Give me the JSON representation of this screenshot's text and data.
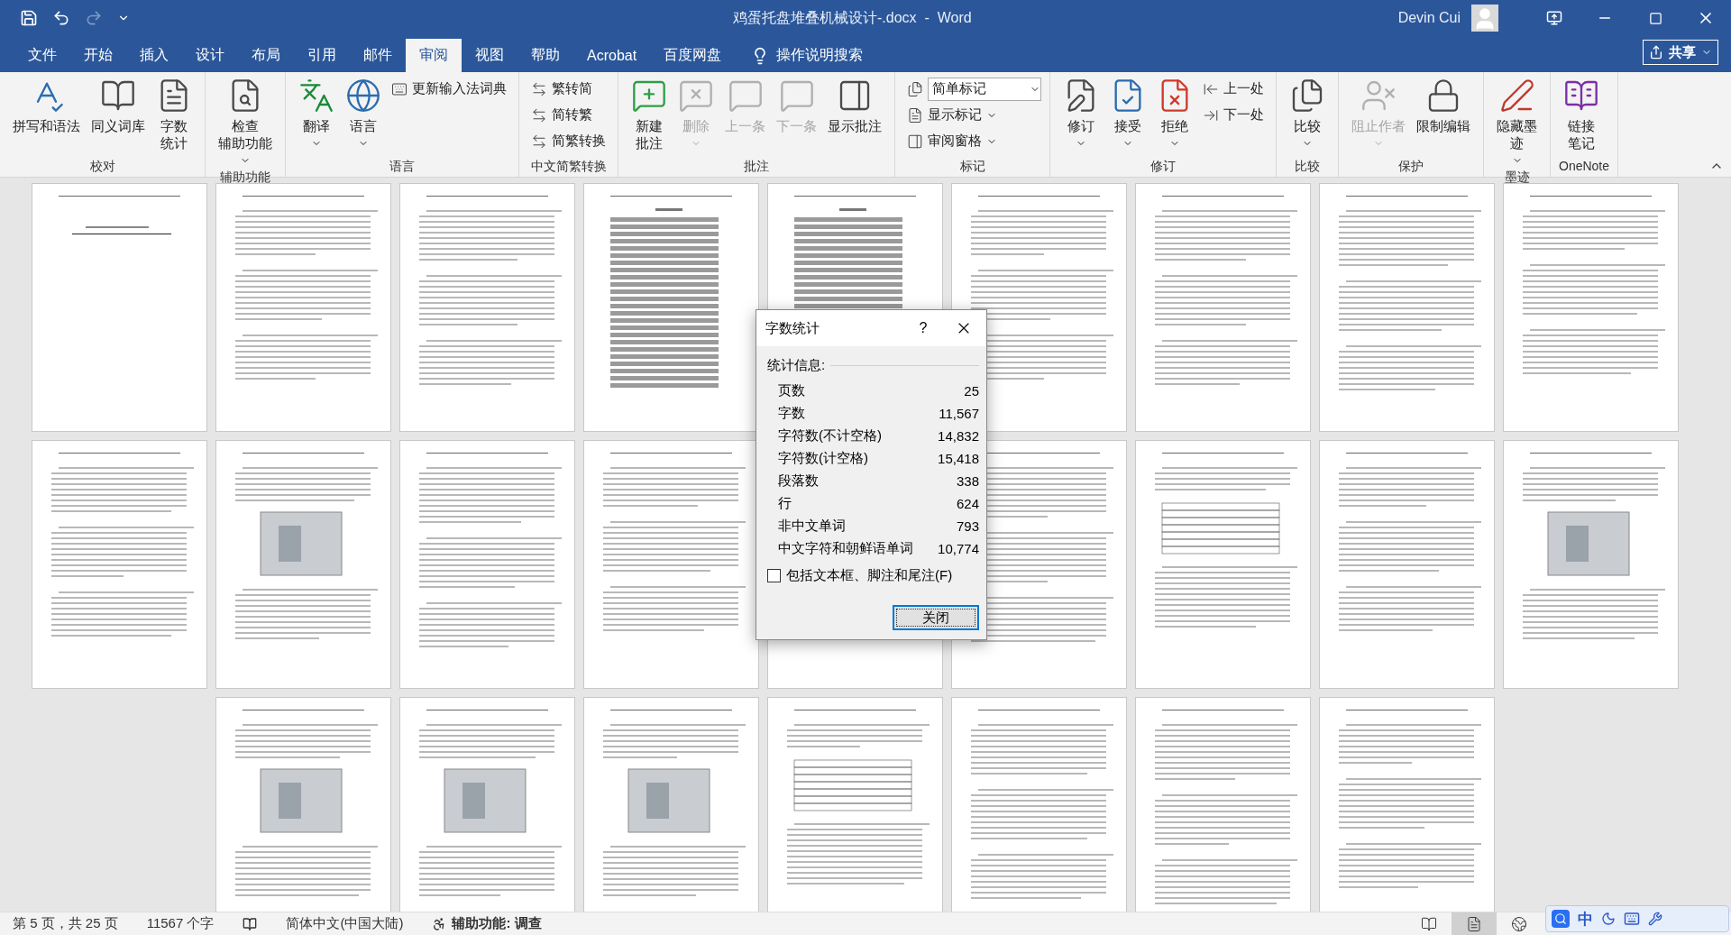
{
  "title_bar": {
    "title": "鸡蛋托盘堆叠机械设计-.docx  -  Word",
    "user": "Devin Cui"
  },
  "menu_tabs": [
    {
      "label": "文件",
      "selected": false
    },
    {
      "label": "开始",
      "selected": false
    },
    {
      "label": "插入",
      "selected": false
    },
    {
      "label": "设计",
      "selected": false
    },
    {
      "label": "布局",
      "selected": false
    },
    {
      "label": "引用",
      "selected": false
    },
    {
      "label": "邮件",
      "selected": false
    },
    {
      "label": "审阅",
      "selected": true
    },
    {
      "label": "视图",
      "selected": false
    },
    {
      "label": "帮助",
      "selected": false
    },
    {
      "label": "Acrobat",
      "selected": false
    },
    {
      "label": "百度网盘",
      "selected": false
    }
  ],
  "tell_me": "操作说明搜索",
  "share": "共享",
  "ribbon_groups": [
    {
      "label": "校对",
      "items": [
        {
          "kind": "large",
          "lines": [
            "拼写和语法"
          ],
          "disabled": false
        },
        {
          "kind": "large",
          "lines": [
            "同义词库"
          ],
          "disabled": false
        },
        {
          "kind": "large",
          "lines": [
            "字数",
            "统计"
          ],
          "disabled": false
        }
      ]
    },
    {
      "label": "辅助功能",
      "items": [
        {
          "kind": "large",
          "lines": [
            "检查",
            "辅助功能"
          ],
          "disabled": false,
          "dropdown": true
        }
      ]
    },
    {
      "label": "语言",
      "items": [
        {
          "kind": "large",
          "lines": [
            "翻译"
          ],
          "disabled": false,
          "dropdown": true
        },
        {
          "kind": "large",
          "lines": [
            "语言"
          ],
          "disabled": false,
          "dropdown": true
        },
        {
          "kind": "small",
          "lines": [
            "更新输入法词典"
          ],
          "disabled": false
        }
      ]
    },
    {
      "label": "中文简繁转换",
      "items": [
        {
          "kind": "small",
          "lines": [
            "繁转简"
          ],
          "disabled": false
        },
        {
          "kind": "small",
          "lines": [
            "简转繁"
          ],
          "disabled": false
        },
        {
          "kind": "small",
          "lines": [
            "简繁转换"
          ],
          "disabled": false
        }
      ]
    },
    {
      "label": "批注",
      "items": [
        {
          "kind": "large",
          "lines": [
            "新建",
            "批注"
          ],
          "disabled": false
        },
        {
          "kind": "large",
          "lines": [
            "删除"
          ],
          "disabled": true,
          "dropdown": true
        },
        {
          "kind": "large",
          "lines": [
            "上一条"
          ],
          "disabled": true
        },
        {
          "kind": "large",
          "lines": [
            "下一条"
          ],
          "disabled": true
        },
        {
          "kind": "large",
          "lines": [
            "显示批注"
          ],
          "disabled": false
        }
      ]
    },
    {
      "label": "标记",
      "items": [
        {
          "kind": "select",
          "lines": [
            "简单标记"
          ],
          "disabled": false
        },
        {
          "kind": "small",
          "lines": [
            "显示标记"
          ],
          "disabled": false,
          "dropdown": true
        },
        {
          "kind": "small",
          "lines": [
            "审阅窗格"
          ],
          "disabled": false,
          "dropdown": true
        }
      ]
    },
    {
      "label": "修订",
      "items": [
        {
          "kind": "large",
          "lines": [
            "修订"
          ],
          "disabled": false,
          "dropdown": true
        },
        {
          "kind": "large",
          "lines": [
            "接受"
          ],
          "disabled": false,
          "dropdown": true
        },
        {
          "kind": "large",
          "lines": [
            "拒绝"
          ],
          "disabled": false,
          "dropdown": true
        },
        {
          "kind": "small",
          "lines": [
            "上一处"
          ],
          "disabled": false
        },
        {
          "kind": "small",
          "lines": [
            "下一处"
          ],
          "disabled": false
        }
      ]
    },
    {
      "label": "比较",
      "items": [
        {
          "kind": "large",
          "lines": [
            "比较"
          ],
          "disabled": false,
          "dropdown": true
        }
      ]
    },
    {
      "label": "保护",
      "items": [
        {
          "kind": "large",
          "lines": [
            "阻止作者"
          ],
          "disabled": true,
          "dropdown": true
        },
        {
          "kind": "large",
          "lines": [
            "限制编辑"
          ],
          "disabled": false
        }
      ]
    },
    {
      "label": "墨迹",
      "items": [
        {
          "kind": "large",
          "lines": [
            "隐藏墨",
            "迹"
          ],
          "disabled": false,
          "dropdown": true
        }
      ]
    },
    {
      "label": "OneNote",
      "items": [
        {
          "kind": "large",
          "lines": [
            "链接",
            "笔记"
          ],
          "disabled": false
        }
      ]
    }
  ],
  "pages": [
    {
      "kind": "title"
    },
    {
      "kind": "text"
    },
    {
      "kind": "text"
    },
    {
      "kind": "toc"
    },
    {
      "kind": "toc"
    },
    {
      "kind": "text"
    },
    {
      "kind": "text"
    },
    {
      "kind": "text"
    },
    {
      "kind": "text"
    },
    {
      "kind": "text"
    },
    {
      "kind": "figure"
    },
    {
      "kind": "text"
    },
    {
      "kind": "text"
    },
    {
      "kind": "text"
    },
    {
      "kind": "text"
    },
    {
      "kind": "table"
    },
    {
      "kind": "text"
    },
    {
      "kind": "figure"
    },
    {
      "kind": "figure"
    },
    {
      "kind": "figure"
    },
    {
      "kind": "figure"
    },
    {
      "kind": "table"
    },
    {
      "kind": "text"
    },
    {
      "kind": "text"
    },
    {
      "kind": "text"
    }
  ],
  "dialog": {
    "title": "字数统计",
    "help": "?",
    "section": "统计信息:",
    "stats": [
      {
        "label": "页数",
        "value": "25"
      },
      {
        "label": "字数",
        "value": "11,567"
      },
      {
        "label": "字符数(不计空格)",
        "value": "14,832"
      },
      {
        "label": "字符数(计空格)",
        "value": "15,418"
      },
      {
        "label": "段落数",
        "value": "338"
      },
      {
        "label": "行",
        "value": "624"
      },
      {
        "label": "非中文单词",
        "value": "793"
      },
      {
        "label": "中文字符和朝鲜语单词",
        "value": "10,774"
      }
    ],
    "checkbox": {
      "label": "包括文本框、脚注和尾注(F)",
      "checked": false
    },
    "button": "关闭"
  },
  "status_bar": {
    "page": "第 5 页，共 25 页",
    "words": "11567 个字",
    "language": "简体中文(中国大陆)",
    "accessibility": "辅助功能: 调查",
    "views": [
      {
        "kind": "read",
        "selected": false
      },
      {
        "kind": "print",
        "selected": true
      },
      {
        "kind": "web",
        "selected": false
      }
    ]
  },
  "ime": {
    "mode": "中"
  }
}
